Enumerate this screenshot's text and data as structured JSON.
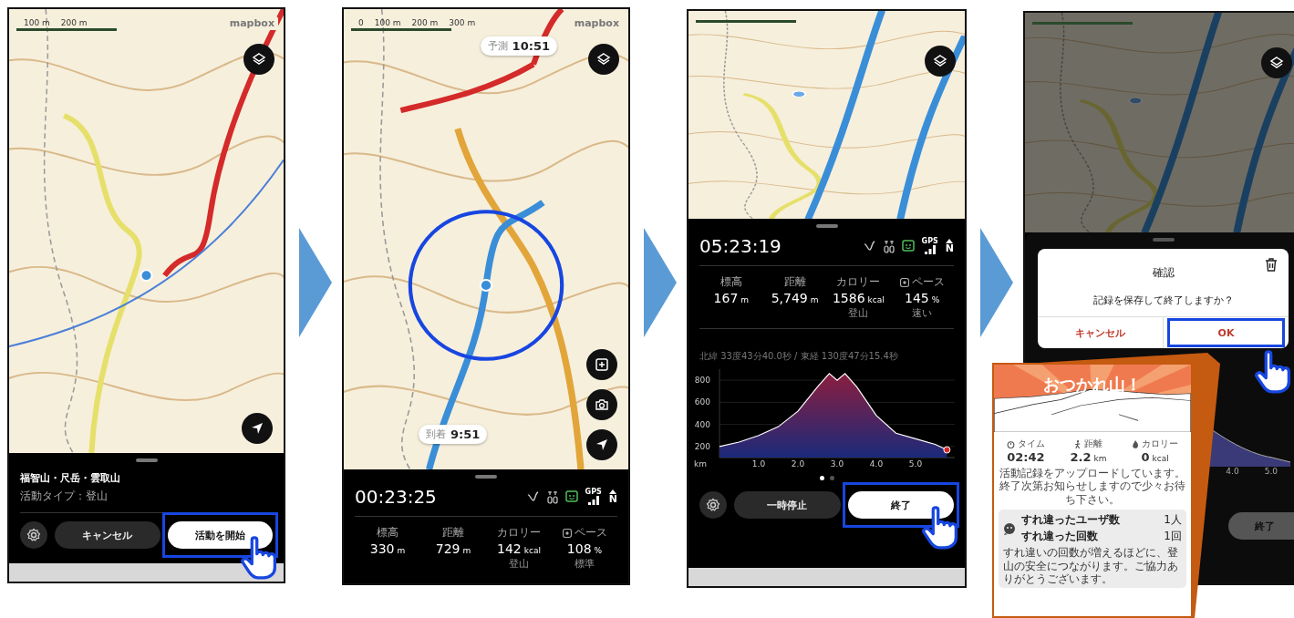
{
  "step1": {
    "map": {
      "scale_labels": [
        "100 m",
        "200 m"
      ],
      "attribution": "mapbox"
    },
    "route_title": "福智山・尺岳・雲取山",
    "activity_type": "活動タイプ：登山",
    "buttons": [
      {
        "kind": "settings",
        "highlighted": false
      },
      {
        "kind": "secondary",
        "label": "キャンセル",
        "highlighted": false
      },
      {
        "kind": "primary",
        "label": "活動を開始",
        "highlighted": true
      }
    ]
  },
  "step2": {
    "map": {
      "scale_labels": [
        "0",
        "100 m",
        "200 m",
        "300 m"
      ],
      "attribution": "mapbox"
    },
    "bubbles": [
      {
        "label": "予測",
        "time": "10:51"
      },
      {
        "label": "到着",
        "time": "9:51"
      }
    ],
    "timer": "00:23:25",
    "gps_label": "GPS",
    "north_label": "N",
    "stats": [
      {
        "kind": "plain",
        "label": "標高",
        "value": "330",
        "unit": "m"
      },
      {
        "kind": "plain",
        "label": "距離",
        "value": "729",
        "unit": "m"
      },
      {
        "kind": "plain",
        "label": "カロリー",
        "value": "142",
        "unit": "kcal",
        "note": "登山"
      },
      {
        "kind": "pace",
        "label": "ペース",
        "value": "108",
        "unit": "%",
        "note": "標準"
      }
    ]
  },
  "step3": {
    "timer": "05:23:19",
    "gps_label": "GPS",
    "north_label": "N",
    "stats": [
      {
        "kind": "plain",
        "label": "標高",
        "value": "167",
        "unit": "m"
      },
      {
        "kind": "plain",
        "label": "距離",
        "value": "5,749",
        "unit": "m"
      },
      {
        "kind": "plain",
        "label": "カロリー",
        "value": "1586",
        "unit": "kcal",
        "note": "登山"
      },
      {
        "kind": "pace",
        "label": "ペース",
        "value": "145",
        "unit": "%",
        "note": "速い"
      }
    ],
    "coordinates": "北緯 33度43分40.0秒 / 東経 130度47分15.4秒",
    "chart_data": {
      "type": "area",
      "x": [
        0,
        0.5,
        1,
        1.5,
        2,
        2.5,
        2.8,
        3,
        3.2,
        3.5,
        4,
        4.5,
        5,
        5.5,
        5.8
      ],
      "xlabel": "km",
      "xticks": [
        {
          "value": 1,
          "label": "1.0"
        },
        {
          "value": 2,
          "label": "2.0"
        },
        {
          "value": 3,
          "label": "3.0"
        },
        {
          "value": 4,
          "label": "4.0"
        },
        {
          "value": 5,
          "label": "5.0"
        }
      ],
      "yticks": [
        200,
        400,
        600,
        800
      ],
      "xlim": [
        0,
        6
      ],
      "ylim": [
        100,
        900
      ],
      "grid": true,
      "series": [
        {
          "color": "#8b1e3f",
          "values": [
            200,
            240,
            300,
            380,
            520,
            740,
            860,
            800,
            860,
            740,
            480,
            320,
            270,
            220,
            170
          ]
        }
      ]
    },
    "pages": [
      {
        "selected": true
      },
      {
        "selected": false
      }
    ],
    "buttons": [
      {
        "kind": "settings",
        "highlighted": false
      },
      {
        "kind": "secondary",
        "label": "一時停止",
        "highlighted": false
      },
      {
        "kind": "primary",
        "label": "終了",
        "highlighted": true
      }
    ]
  },
  "step4": {
    "dialog": {
      "title": "確認",
      "message": "記録を保存して終了しますか？",
      "buttons": [
        {
          "label": "キャンセル",
          "highlighted": false
        },
        {
          "label": "OK",
          "highlighted": true
        }
      ]
    },
    "axis_labels": [
      "4.0",
      "5.0"
    ],
    "end_button": "終了",
    "summary": {
      "title": "おつかれ山！",
      "stats": [
        {
          "kind": "time",
          "label": "タイム",
          "value": "02:42"
        },
        {
          "kind": "distance",
          "label": "距離",
          "value": "2.2",
          "unit": "km"
        },
        {
          "kind": "calorie",
          "label": "カロリー",
          "value": "0",
          "unit": "kcal"
        }
      ],
      "message_lines": [
        "活動記録をアップロードしています。",
        "終了次第お知らせしますので少々お待ち下さい。"
      ],
      "encounters": [
        {
          "label": "すれ違ったユーザ数",
          "value": "1人"
        },
        {
          "label": "すれ違った回数",
          "value": "1回"
        }
      ],
      "note": "すれ違いの回数が増えるほどに、登山の安全につながります。ご協力ありがとうございます。"
    }
  }
}
